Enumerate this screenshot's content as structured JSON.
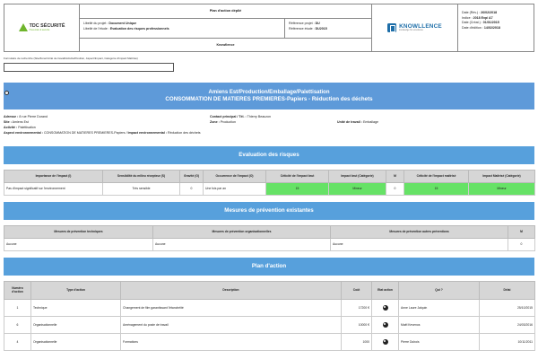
{
  "header": {
    "left_logo": {
      "name": "TDC SÉCURITÉ",
      "tagline": "Prévention & sécurité"
    },
    "center_top": "Plan d'action déplié",
    "labels": {
      "project_label": "Libellé du projet :",
      "project_value": "Document Unique",
      "study_label": "Libellé de l'étude :",
      "study_value": "Evaluation des risques professionnels",
      "ref_label": "Référence projet :",
      "ref_value": "DU",
      "ref_study_label": "Référence étude :",
      "ref_study_value": "DU2015"
    },
    "company": "Knowllence",
    "right_logo": {
      "name": "KNOWLLENCE",
      "tagline": "knowledge for excellence"
    },
    "meta": [
      {
        "label": "Date (Rév.) :",
        "value": "26/02/2018"
      },
      {
        "label": "Indice :",
        "value": "2018 Exp/ A7"
      },
      {
        "label": "Date (Créat.) :",
        "value": "01/01/2015"
      },
      {
        "label": "Date d'édition :",
        "value": "14/02/2018"
      }
    ]
  },
  "search": {
    "label": "Formulaire de recherche (Site/Zone/Unité de travail/Activité/Position, Aspect/Impact, Catégorie d'impact Maîtrisé)",
    "value": ""
  },
  "title_band": {
    "line1": "Amiens Est/Production/Emballage/Palettisation",
    "line2": "CONSOMMATION DE MATIERES PREMIERES-Papiers  - Réduction des déchets"
  },
  "info": {
    "adresse_label": "Adresse :",
    "adresse": "8 rue Pierre Durand",
    "contact_label": "Contact principal / Tél. :",
    "contact": "Thierry Beauzon",
    "site_label": "Site :",
    "site": "Amiens Est",
    "zone_label": "Zone :",
    "zone": "Production",
    "unite_label": "Unité de travail :",
    "unite": "Emballage",
    "activite_label": "Activité :",
    "activite": "Palettisation",
    "aspect_label": "Aspect environnemental :",
    "aspect": "CONSOMMATION DE MATIERES PREMIERES-Papiers",
    "impact_label": "Impact environnemental :",
    "impact": "Réduction des déchets"
  },
  "eval": {
    "title": "Evaluation des risques",
    "headers": [
      "Importance de l'impact (I)",
      "Sensibilité du milieu récepteur (S)",
      "Gravité (G)",
      "Occurrence de l'impact (O)",
      "Criticité de l'impact brut",
      "Impact brut (Catégorie)",
      "M",
      "Criticité de l'impact maîtrisé",
      "Impact Maîtrisé (Catégorie)"
    ],
    "row": [
      "Pas d'impact significatif sur l'environnement",
      "Très sensible",
      "0",
      "Une fois par an",
      "15",
      "Mineur",
      "0",
      "15",
      "Mineur"
    ]
  },
  "prevention": {
    "title": "Mesures de prévention existantes",
    "headers": [
      "Mesures de prévention techniques",
      "Mesures de prévention organisationnelles",
      "Mesures de prévention autres préventions",
      "M"
    ],
    "row": [
      "Aucune",
      "Aucune",
      "Aucune",
      "0"
    ]
  },
  "plan": {
    "title": "Plan d'action",
    "headers": [
      "Numéro d'action",
      "Type d'action",
      "Description",
      "Coût",
      "Etat action",
      "Qui ?",
      "Délai"
    ],
    "rows": [
      [
        "1",
        "Technique",
        "Changement de film garantissant l'étanchéité",
        "17200 €",
        "",
        "Anne Laure Jalquin",
        "25/10/2015"
      ],
      [
        "6",
        "Organisationnelle",
        "Aménagement du poste de travail",
        "10000 €",
        "",
        "Maël Kevenos",
        "24/03/2016"
      ],
      [
        "4",
        "Organisationnelle",
        "Formations",
        "1000",
        "",
        "Pierre Dubois",
        "10/11/2011"
      ]
    ]
  }
}
